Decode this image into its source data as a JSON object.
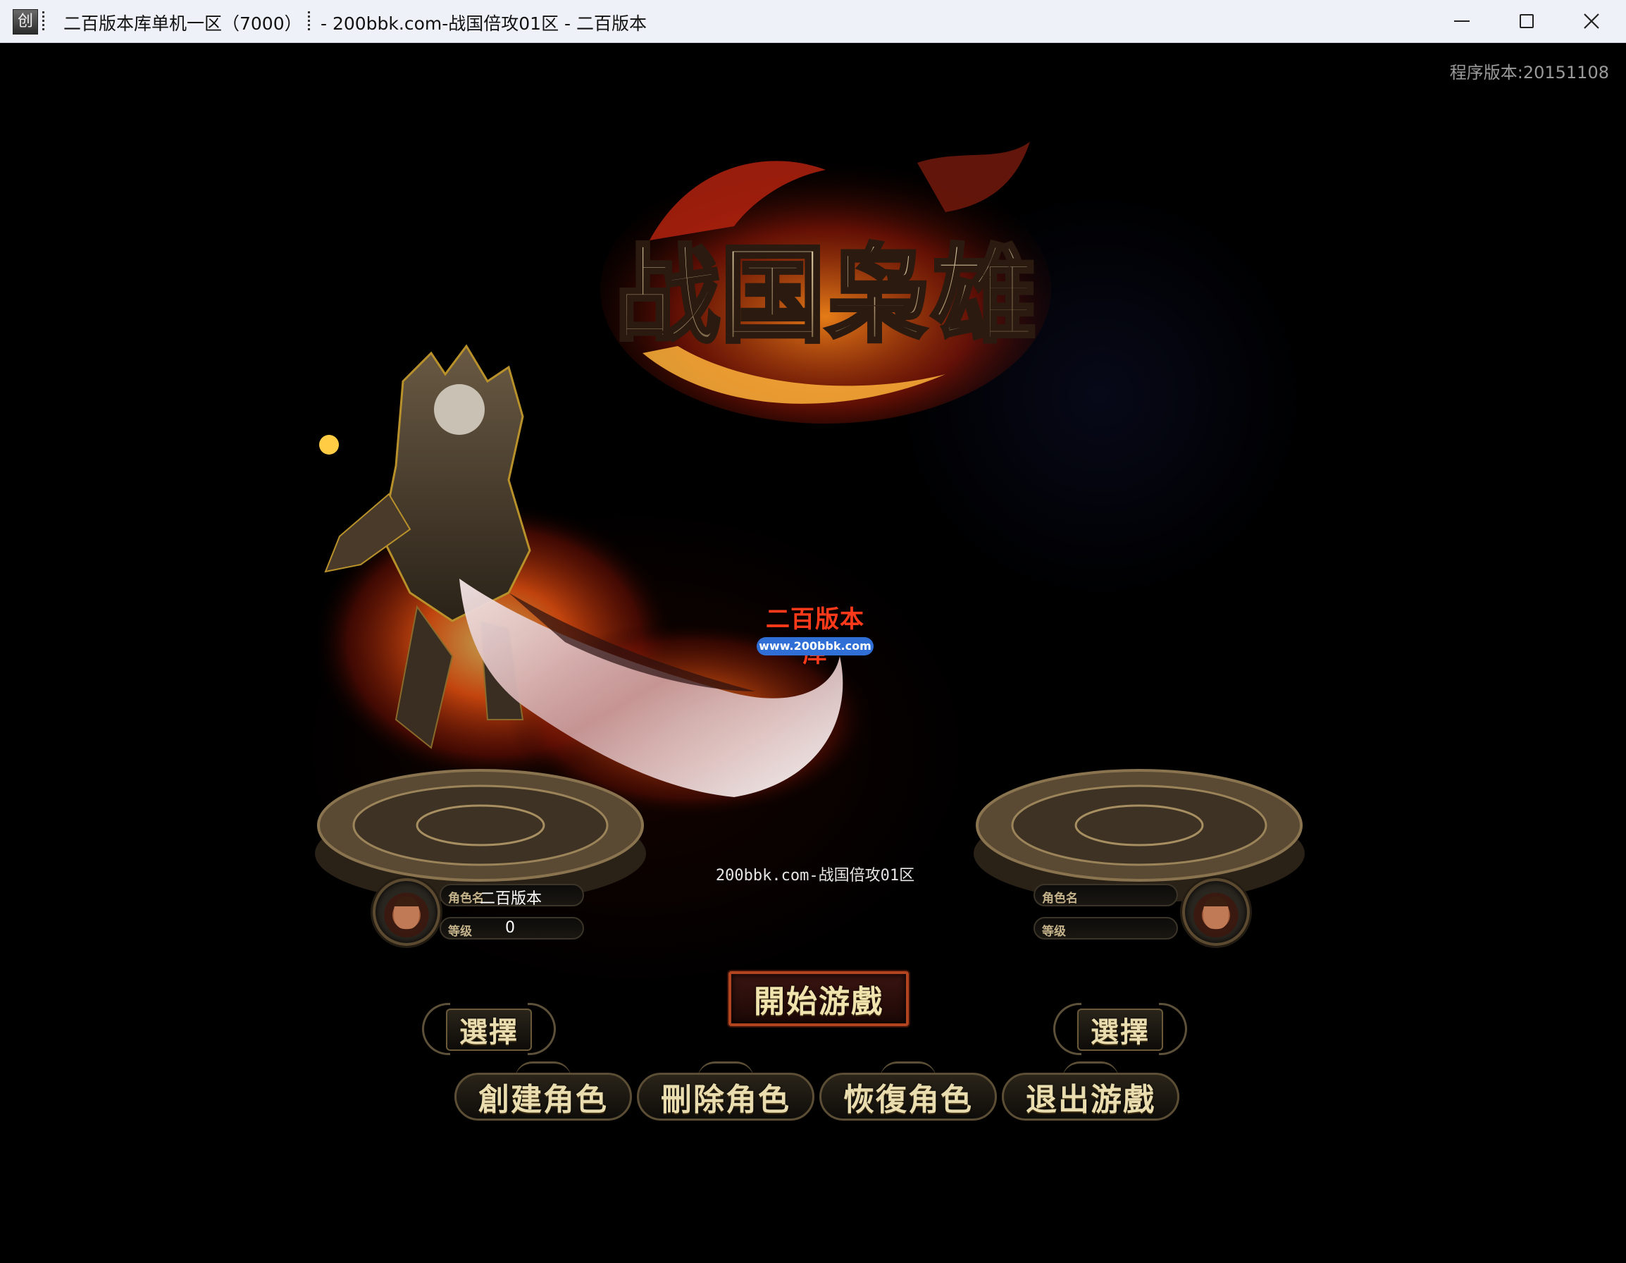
{
  "window": {
    "icon_glyph": "创",
    "title_left": "二百版本库单机一区（7000）",
    "title_right": "- 200bbk.com-战国倍攻01区 - 二百版本",
    "minimize_icon": "minimize-icon",
    "maximize_icon": "maximize-icon",
    "close_icon": "close-icon"
  },
  "game": {
    "version": "程序版本:20151108",
    "logo_text": "战国枭雄",
    "watermark": {
      "title": "二百版本库",
      "url": "www.200bbk.com"
    },
    "server_name": "200bbk.com-战国倍攻01区",
    "slot_left": {
      "name_label": "角色名",
      "name_value": "二百版本",
      "level_label": "等级",
      "level_value": "0"
    },
    "slot_right": {
      "name_label": "角色名",
      "name_value": "",
      "level_label": "等级",
      "level_value": ""
    },
    "select_left_label": "選擇",
    "select_right_label": "選擇",
    "start_label": "開始游戲",
    "actions": {
      "create": "創建角色",
      "delete": "刪除角色",
      "restore": "恢復角色",
      "exit": "退出游戲"
    },
    "colors": {
      "background": "#000000",
      "gold_text": "#e9dcae",
      "start_border": "#b2451f",
      "watermark_red": "#ff3a1a",
      "watermark_blue": "#2f6fd6"
    }
  }
}
